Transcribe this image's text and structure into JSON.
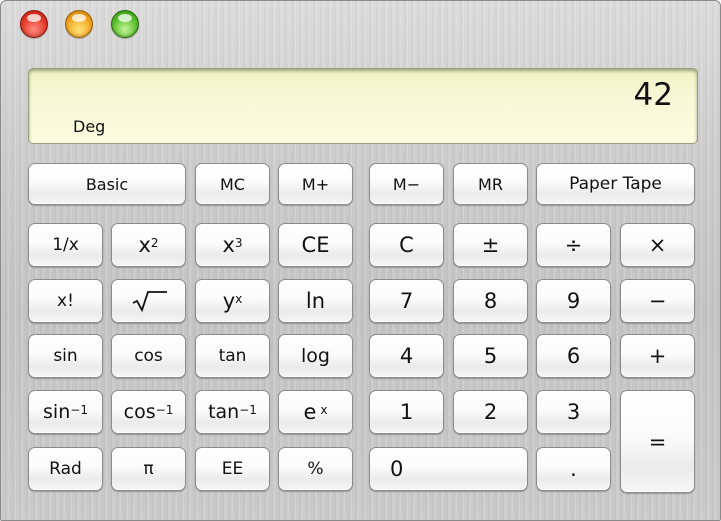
{
  "window": {
    "title_lights": [
      "close",
      "minimize",
      "zoom"
    ]
  },
  "display": {
    "value": "42",
    "mode": "Deg"
  },
  "top_row": {
    "basic": "Basic",
    "mc": "MC",
    "mplus": "M+",
    "mminus": "M−",
    "mr": "MR",
    "paper_tape": "Paper Tape"
  },
  "keys": {
    "recip": "1/x",
    "x2": "x",
    "x2_sup": "2",
    "x3": "x",
    "x3_sup": "3",
    "ce": "CE",
    "c": "C",
    "plusminus": "±",
    "divide": "÷",
    "multiply": "×",
    "fact": "x!",
    "sqrt": "√‾‾",
    "yx": "y",
    "yx_sup": "x",
    "ln": "ln",
    "seven": "7",
    "eight": "8",
    "nine": "9",
    "minus": "−",
    "sin": "sin",
    "cos": "cos",
    "tan": "tan",
    "log": "log",
    "four": "4",
    "five": "5",
    "six": "6",
    "plus": "+",
    "asin": "sin",
    "asin_sup": "−1",
    "acos": "cos",
    "acos_sup": "−1",
    "atan": "tan",
    "atan_sup": "−1",
    "ex": "e",
    "ex_sup": "x",
    "one": "1",
    "two": "2",
    "three": "3",
    "equals": "=",
    "rad": "Rad",
    "pi": "π",
    "ee": "EE",
    "percent": "%",
    "zero": "0",
    "decimal": "."
  }
}
